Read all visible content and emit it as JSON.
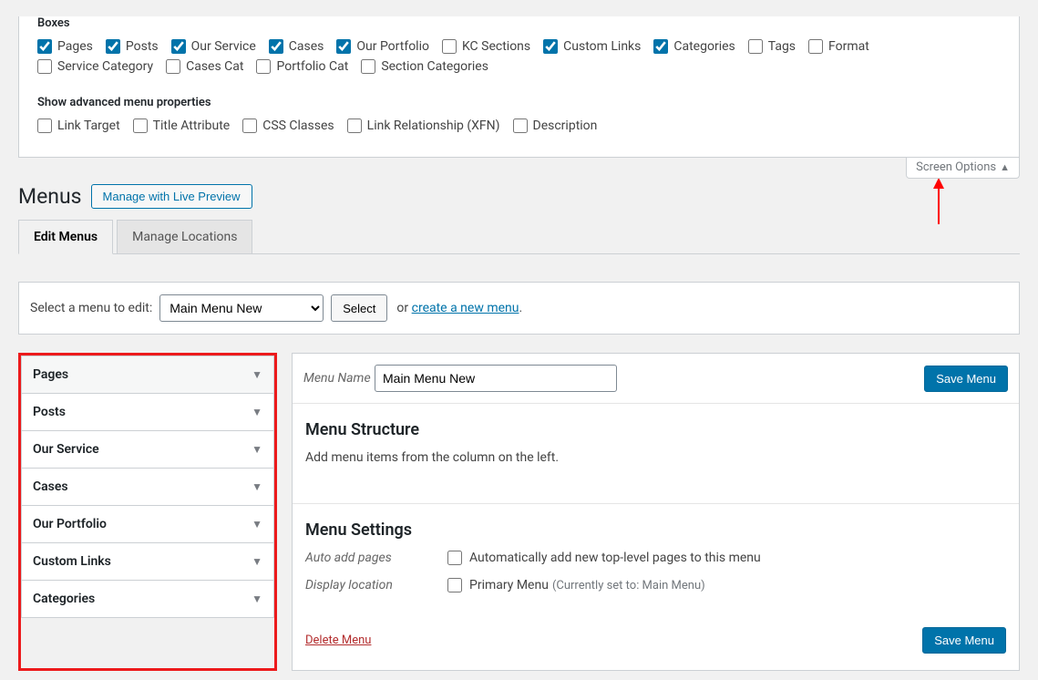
{
  "screen_options": {
    "boxes_title": "Boxes",
    "boxes": [
      {
        "label": "Pages",
        "checked": true
      },
      {
        "label": "Posts",
        "checked": true
      },
      {
        "label": "Our Service",
        "checked": true
      },
      {
        "label": "Cases",
        "checked": true
      },
      {
        "label": "Our Portfolio",
        "checked": true
      },
      {
        "label": "KC Sections",
        "checked": false
      },
      {
        "label": "Custom Links",
        "checked": true
      },
      {
        "label": "Categories",
        "checked": true
      },
      {
        "label": "Tags",
        "checked": false
      },
      {
        "label": "Format",
        "checked": false
      },
      {
        "label": "Service Category",
        "checked": false
      },
      {
        "label": "Cases Cat",
        "checked": false
      },
      {
        "label": "Portfolio Cat",
        "checked": false
      },
      {
        "label": "Section Categories",
        "checked": false
      }
    ],
    "advanced_title": "Show advanced menu properties",
    "advanced": [
      {
        "label": "Link Target",
        "checked": false
      },
      {
        "label": "Title Attribute",
        "checked": false
      },
      {
        "label": "CSS Classes",
        "checked": false
      },
      {
        "label": "Link Relationship (XFN)",
        "checked": false
      },
      {
        "label": "Description",
        "checked": false
      }
    ],
    "tab_label": "Screen Options"
  },
  "header": {
    "title": "Menus",
    "live_preview": "Manage with Live Preview"
  },
  "tabs": {
    "edit": "Edit Menus",
    "locations": "Manage Locations"
  },
  "select_bar": {
    "prompt": "Select a menu to edit:",
    "selected": "Main Menu New",
    "options": [
      "Main Menu New"
    ],
    "select_btn": "Select",
    "or": "or",
    "create_link": "create a new menu",
    "period": "."
  },
  "accordion": [
    {
      "label": "Pages",
      "shaded": true
    },
    {
      "label": "Posts",
      "shaded": false
    },
    {
      "label": "Our Service",
      "shaded": false
    },
    {
      "label": "Cases",
      "shaded": false
    },
    {
      "label": "Our Portfolio",
      "shaded": false
    },
    {
      "label": "Custom Links",
      "shaded": false
    },
    {
      "label": "Categories",
      "shaded": false
    }
  ],
  "menu": {
    "name_lbl": "Menu Name",
    "name_value": "Main Menu New",
    "save": "Save Menu",
    "structure_title": "Menu Structure",
    "structure_hint": "Add menu items from the column on the left.",
    "settings_title": "Menu Settings",
    "auto_add_lbl": "Auto add pages",
    "auto_add_opt": "Automatically add new top-level pages to this menu",
    "display_loc_lbl": "Display location",
    "display_loc_opt": "Primary Menu",
    "display_loc_note": "(Currently set to: Main Menu)",
    "delete": "Delete Menu"
  }
}
